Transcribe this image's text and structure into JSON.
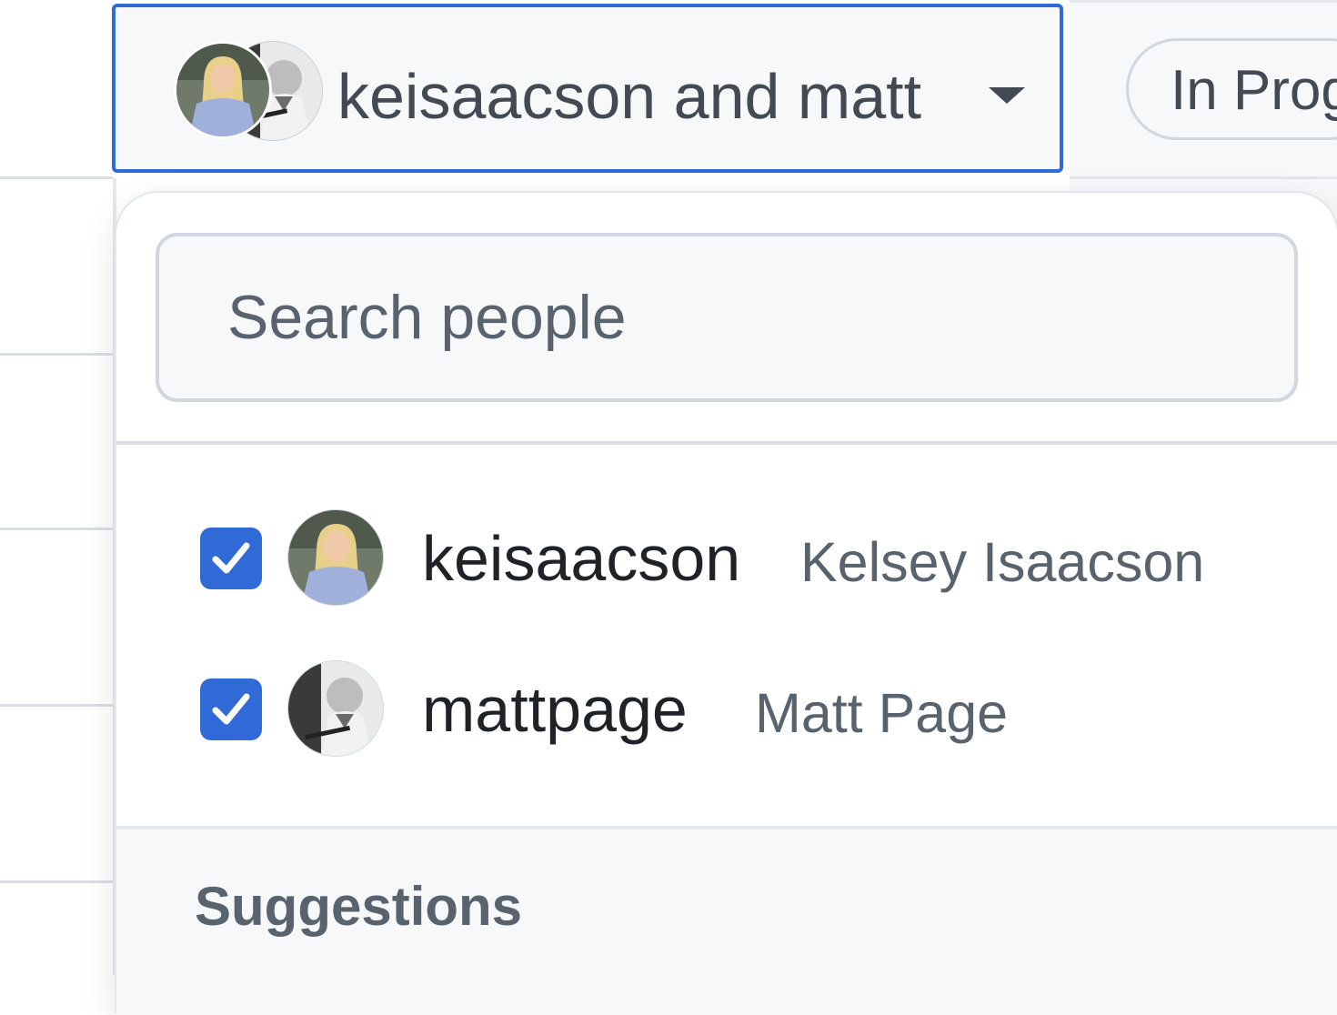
{
  "assignees_button": {
    "label": "keisaacson and matt",
    "avatars": [
      "keisaacson",
      "mattpage"
    ]
  },
  "status": {
    "label": "In Prog"
  },
  "search": {
    "placeholder": "Search people",
    "value": ""
  },
  "selected_people": [
    {
      "username": "keisaacson",
      "full_name": "Kelsey Isaacson",
      "checked": true
    },
    {
      "username": "mattpage",
      "full_name": "Matt Page",
      "checked": true
    }
  ],
  "suggestions": {
    "title": "Suggestions"
  },
  "colors": {
    "accent": "#2f6ad6",
    "muted_text": "#59636e",
    "border": "#d0d7de"
  }
}
